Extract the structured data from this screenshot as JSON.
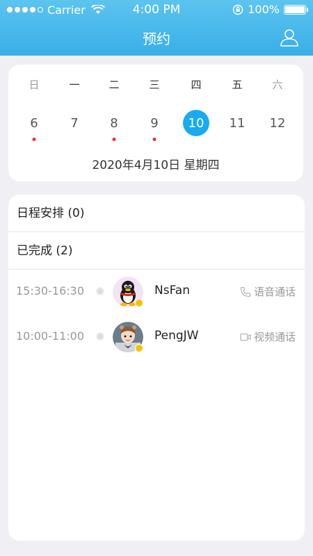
{
  "status_bar": {
    "carrier": "Carrier",
    "time": "4:00 PM",
    "battery": "100%"
  },
  "nav": {
    "title": "预约",
    "profile_icon": "user-icon"
  },
  "calendar": {
    "weekdays": [
      "日",
      "一",
      "二",
      "三",
      "四",
      "五",
      "六"
    ],
    "dates": [
      {
        "day": "6",
        "has_event": true
      },
      {
        "day": "7",
        "has_event": false
      },
      {
        "day": "8",
        "has_event": true
      },
      {
        "day": "9",
        "has_event": true
      },
      {
        "day": "10",
        "has_event": false,
        "selected": true
      },
      {
        "day": "11",
        "has_event": false
      },
      {
        "day": "12",
        "has_event": false
      }
    ],
    "selected_date_label": "2020年4月10日   星期四"
  },
  "sections": {
    "schedule": "日程安排 (0)",
    "completed": "已完成 (2)"
  },
  "appointments": [
    {
      "time": "15:30-16:30",
      "name": "NsFan",
      "call_type": "语音通话",
      "call_icon": "phone-icon",
      "avatar": "penguin-avatar"
    },
    {
      "time": "10:00-11:00",
      "name": "PengJW",
      "call_type": "视频通话",
      "call_icon": "video-icon",
      "avatar": "person-avatar"
    }
  ],
  "colors": {
    "header": "#3aaee7",
    "accent": "#1aabef",
    "event_dot": "#e8323c"
  }
}
